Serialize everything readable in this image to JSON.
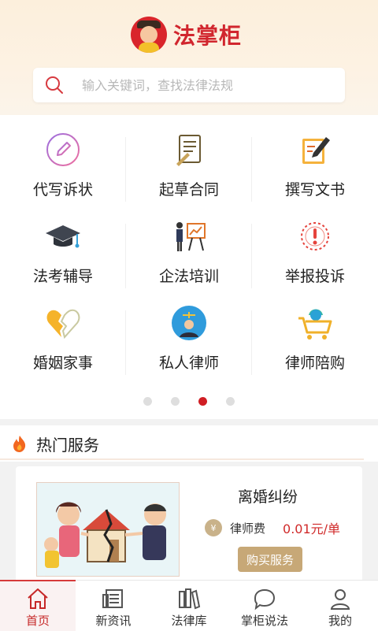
{
  "app": {
    "title": "法掌柜"
  },
  "search": {
    "placeholder": "输入关键词，查找法律法规"
  },
  "services": [
    {
      "label": "代写诉状",
      "icon": "pen-circle-icon"
    },
    {
      "label": "起草合同",
      "icon": "contract-document-icon"
    },
    {
      "label": "撰写文书",
      "icon": "writing-pen-icon"
    },
    {
      "label": "法考辅导",
      "icon": "graduation-cap-icon"
    },
    {
      "label": "企法培训",
      "icon": "presentation-board-icon"
    },
    {
      "label": "举报投诉",
      "icon": "alert-exclamation-icon"
    },
    {
      "label": "婚姻家事",
      "icon": "broken-heart-icon"
    },
    {
      "label": "私人律师",
      "icon": "lawyer-avatar-icon"
    },
    {
      "label": "律师陪购",
      "icon": "shopping-cart-icon"
    }
  ],
  "carousel": {
    "pages": 4,
    "active": 3
  },
  "hot": {
    "title": "热门服务",
    "card": {
      "title": "离婚纠纷",
      "fee_label": "律师费",
      "fee_price": "0.01元/单",
      "button": "购买服务"
    }
  },
  "tabbar": [
    {
      "label": "首页",
      "icon": "home-icon",
      "active": true
    },
    {
      "label": "新资讯",
      "icon": "newspaper-icon",
      "active": false
    },
    {
      "label": "法律库",
      "icon": "bookshelf-icon",
      "active": false
    },
    {
      "label": "掌柜说法",
      "icon": "chat-bubble-icon",
      "active": false
    },
    {
      "label": "我的",
      "icon": "user-icon",
      "active": false
    }
  ],
  "colors": {
    "brand": "#d1262e",
    "accent_gold": "#c7a877",
    "price": "#d02a2a"
  }
}
